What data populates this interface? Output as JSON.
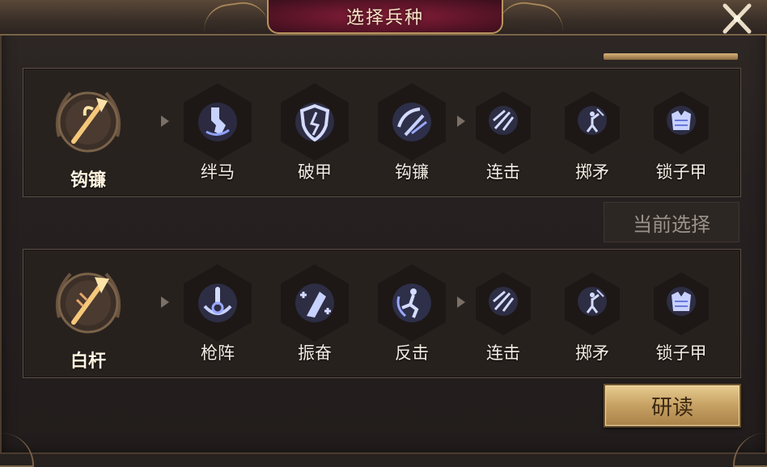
{
  "header": {
    "title": "选择兵种"
  },
  "icons": {
    "close": "close-x-icon",
    "arrow": "chevron-right-icon"
  },
  "colors": {
    "skill_glow": "#8fa0ff",
    "gold": "#d7b171",
    "title_plate": "#7a1a33"
  },
  "troops": [
    {
      "name": "钩镰",
      "icon": "hook-sickle-spear-icon",
      "selected": true,
      "skills": [
        {
          "label": "绊马",
          "icon": "trip-horse-icon",
          "tier": "large"
        },
        {
          "label": "破甲",
          "icon": "broken-shield-icon",
          "tier": "large"
        },
        {
          "label": "钩镰",
          "icon": "hook-blade-icon",
          "tier": "large"
        },
        {
          "label": "连击",
          "icon": "combo-arrows-icon",
          "tier": "small"
        },
        {
          "label": "掷矛",
          "icon": "spear-throw-icon",
          "tier": "small"
        },
        {
          "label": "锁子甲",
          "icon": "chainmail-icon",
          "tier": "small"
        }
      ]
    },
    {
      "name": "白杆",
      "icon": "white-pole-spear-icon",
      "selected": false,
      "skills": [
        {
          "label": "枪阵",
          "icon": "spear-formation-icon",
          "tier": "large"
        },
        {
          "label": "振奋",
          "icon": "rally-icon",
          "tier": "large"
        },
        {
          "label": "反击",
          "icon": "counter-attack-icon",
          "tier": "large"
        },
        {
          "label": "连击",
          "icon": "combo-arrows-icon",
          "tier": "small"
        },
        {
          "label": "掷矛",
          "icon": "spear-throw-icon",
          "tier": "small"
        },
        {
          "label": "锁子甲",
          "icon": "chainmail-icon",
          "tier": "small"
        }
      ]
    }
  ],
  "current_selection_label": "当前选择",
  "study_button_label": "研读"
}
